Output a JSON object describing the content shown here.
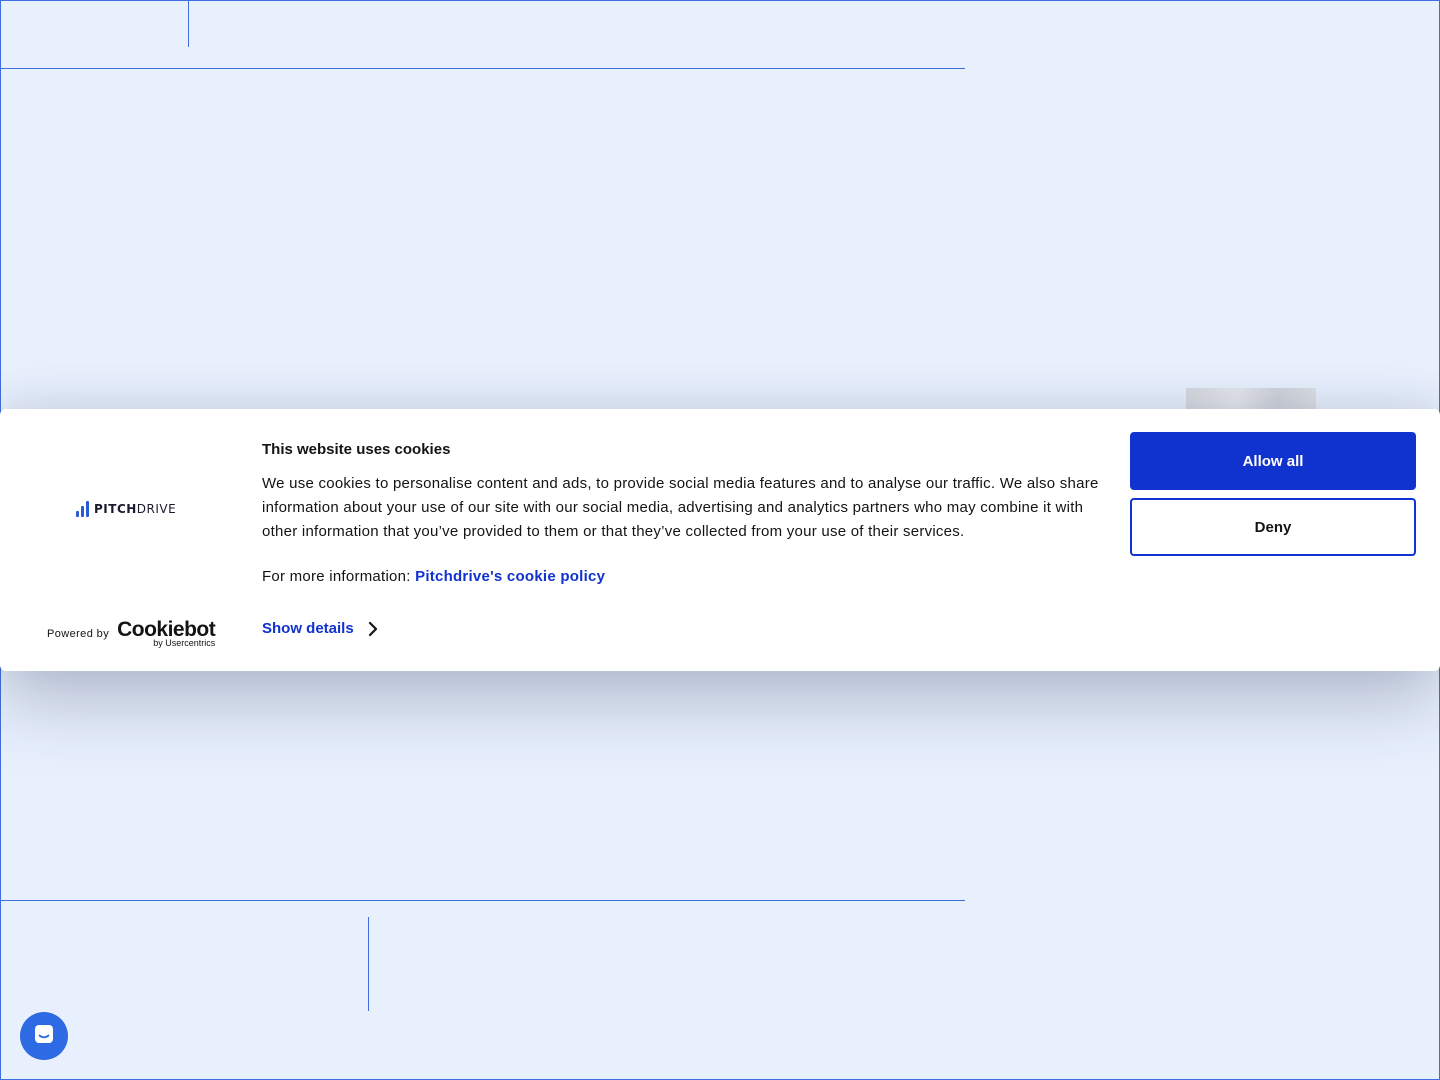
{
  "cookie_banner": {
    "logo": {
      "text_bold": "PITCH",
      "text_regular": "DRIVE",
      "icon": "pitchdrive-bars-icon"
    },
    "title": "This website uses cookies",
    "description": "We use cookies to personalise content and ads, to provide social media features and to analyse our traffic. We also share information about your use of our site with our social media, advertising and analytics partners who may combine it with other information that you’ve provided to them or that they’ve collected from your use of their services.",
    "more_info_label": "For more information:",
    "policy_link_label": "Pitchdrive's cookie policy",
    "show_details_label": "Show details",
    "allow_all_label": "Allow all",
    "deny_label": "Deny",
    "powered_by_label": "Powered by",
    "cookiebot_brand": "Cookiebot",
    "cookiebot_sub": "by Usercentrics"
  },
  "chat_launcher": {
    "icon": "chat-bubble-icon"
  },
  "colors": {
    "page_background": "#e8f0fe",
    "accent_lines": "#3d6fe0",
    "primary_button": "#1032cf",
    "link": "#1032cf",
    "chat_launcher": "#2d6ae3"
  }
}
